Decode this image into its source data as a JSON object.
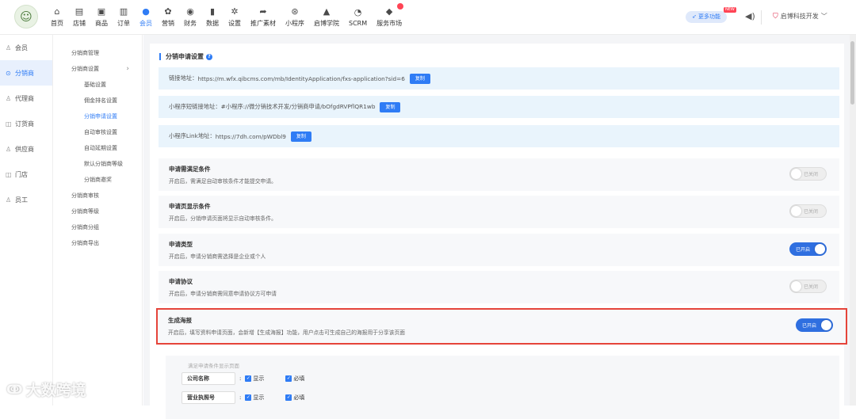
{
  "header": {
    "nav": [
      {
        "label": "首页",
        "icon": "home-icon",
        "glyph": "⌂"
      },
      {
        "label": "店铺",
        "icon": "store-icon",
        "glyph": "▤"
      },
      {
        "label": "商品",
        "icon": "goods-icon",
        "glyph": "▣"
      },
      {
        "label": "订单",
        "icon": "order-icon",
        "glyph": "▥"
      },
      {
        "label": "会员",
        "icon": "member-icon",
        "glyph": "●"
      },
      {
        "label": "营销",
        "icon": "marketing-icon",
        "glyph": "✿"
      },
      {
        "label": "财务",
        "icon": "finance-icon",
        "glyph": "◉"
      },
      {
        "label": "数据",
        "icon": "data-icon",
        "glyph": "▮"
      },
      {
        "label": "设置",
        "icon": "settings-icon",
        "glyph": "✲"
      },
      {
        "label": "推广素材",
        "icon": "share-icon",
        "glyph": "➦"
      },
      {
        "label": "小程序",
        "icon": "miniapp-icon",
        "glyph": "⊛"
      },
      {
        "label": "启博学院",
        "icon": "graduation-icon",
        "glyph": "▲"
      },
      {
        "label": "SCRM",
        "icon": "scrm-icon",
        "glyph": "◔"
      },
      {
        "label": "服务市场",
        "icon": "market-icon",
        "glyph": "◆"
      }
    ],
    "active_nav": "会员",
    "more_label": "更多功能",
    "new_badge": "NEW",
    "company": "启博科技开发"
  },
  "sidebar": [
    {
      "label": "会员",
      "icon": "user-icon",
      "glyph": "♙"
    },
    {
      "label": "分销商",
      "icon": "distributor-icon",
      "glyph": "⊙"
    },
    {
      "label": "代理商",
      "icon": "agent-icon",
      "glyph": "♙"
    },
    {
      "label": "订货商",
      "icon": "ordering-icon",
      "glyph": "◫"
    },
    {
      "label": "供应商",
      "icon": "supplier-icon",
      "glyph": "♙"
    },
    {
      "label": "门店",
      "icon": "shop-icon",
      "glyph": "◫"
    },
    {
      "label": "员工",
      "icon": "staff-icon",
      "glyph": "♙"
    }
  ],
  "submenu": [
    {
      "label": "分销商管理",
      "nested": false
    },
    {
      "label": "分销商设置",
      "nested": false,
      "expand": "›"
    },
    {
      "label": "基础设置",
      "nested": true
    },
    {
      "label": "佣金排名设置",
      "nested": true
    },
    {
      "label": "分销申请设置",
      "nested": true,
      "active": true
    },
    {
      "label": "自动审核设置",
      "nested": true
    },
    {
      "label": "自动延期设置",
      "nested": true
    },
    {
      "label": "默认分销商等级",
      "nested": true
    },
    {
      "label": "分销商邀奖",
      "nested": true
    },
    {
      "label": "分销商审核",
      "nested": false
    },
    {
      "label": "分销商等级",
      "nested": false
    },
    {
      "label": "分销商分组",
      "nested": false
    },
    {
      "label": "分销商导出",
      "nested": false
    }
  ],
  "content": {
    "section_title": "分销申请设置",
    "help_glyph": "?",
    "links": [
      {
        "label": "链接地址：",
        "value": "https://m.wfx.qibcms.com/mb/IdentityApplication/fxs-application?sid=6",
        "button": "复制"
      },
      {
        "label": "小程序短链接地址：",
        "value": "#小程序://微分销技术开发/分销商申请/bOfgdRVPflQR1wb",
        "button": "复制"
      },
      {
        "label": "小程序Link地址：",
        "value": "https://7dh.com/pWDbl9",
        "button": "复制"
      }
    ],
    "settings": [
      {
        "title": "申请需满足条件",
        "desc": "开启后，需满足自动审核条件才能提交申请。",
        "toggle": "已关闭",
        "on": false
      },
      {
        "title": "申请页显示条件",
        "desc": "开启后，分销申请页面将显示自动审核条件。",
        "toggle": "已关闭",
        "on": false
      },
      {
        "title": "申请类型",
        "desc": "开启后，申请分销商需选择是企业或个人",
        "toggle": "已开启",
        "on": true
      },
      {
        "title": "申请协议",
        "desc": "开启后，申请分销商需同意申请协议方可申请",
        "toggle": "已关闭",
        "on": false
      },
      {
        "title": "生成海报",
        "desc": "开启后，填写资料申请页面，会新增【生成海报】功能，用户点击可生成自己的海报用于分享该页面",
        "toggle": "已开启",
        "on": true
      }
    ],
    "subfields_title": "满足申请条件显示页面",
    "fields": [
      {
        "name": "公司名称",
        "show": "显示",
        "required": "必填"
      },
      {
        "name": "营业执照号",
        "show": "显示",
        "required": "必填"
      }
    ],
    "colon": ":",
    "check_glyph": "✓"
  },
  "watermark": "大数跨境",
  "colors": {
    "accent": "#2f7cf5",
    "highlight": "#e5443a",
    "link_bg": "#e9f4fc"
  }
}
